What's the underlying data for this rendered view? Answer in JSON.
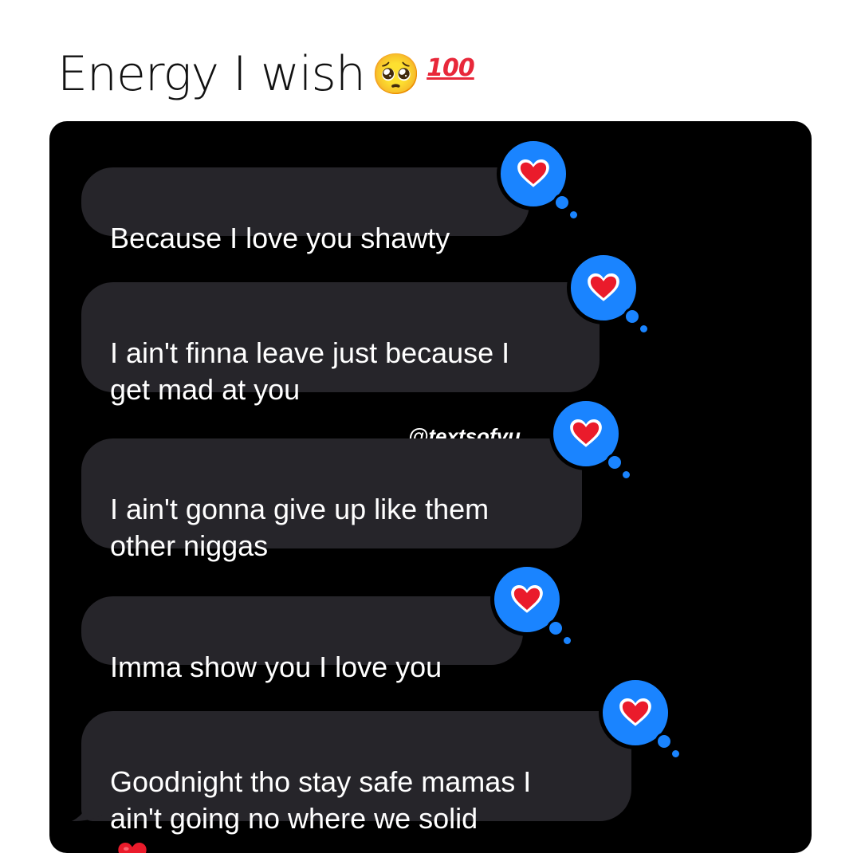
{
  "caption": {
    "text": "Energy I wish",
    "emoji_pleading": "🥺",
    "emoji_hundred": "100"
  },
  "watermark": "@textsofyu",
  "colors": {
    "bubble": "#26252a",
    "reaction_blue": "#1a84ff",
    "heart_red": "#ea1b2b",
    "screen": "#000000"
  },
  "messages": [
    {
      "text": "Because I love you shawty",
      "reaction": "heart-icon"
    },
    {
      "text": "I ain't finna leave just because I\nget mad at you",
      "reaction": "heart-icon"
    },
    {
      "text": "I ain't gonna give up like them\nother niggas",
      "reaction": "heart-icon"
    },
    {
      "text": "Imma show you I love you",
      "reaction": "heart-icon"
    },
    {
      "text": "Goodnight tho stay safe mamas I\nain't going no where we solid",
      "reaction": "heart-icon",
      "trailing_emoji": "heart-icon"
    }
  ]
}
